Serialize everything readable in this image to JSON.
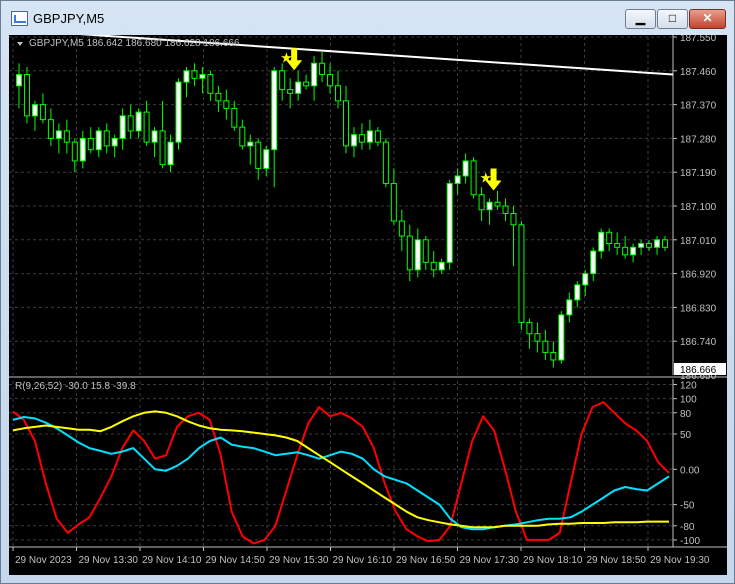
{
  "window": {
    "title": "GBPJPY,M5",
    "minimize_label": "▁",
    "maximize_label": "□",
    "close_label": "✕"
  },
  "main_chart": {
    "header": "GBPJPY,M5  186.642 186.680 186.628 186.666",
    "price_axis": [
      "187.550",
      "187.460",
      "187.370",
      "187.280",
      "187.190",
      "187.100",
      "187.010",
      "186.920",
      "186.830",
      "186.740"
    ],
    "current_price": "186.666",
    "axis_edge_label": "186.650"
  },
  "indicator": {
    "header": "R(9,26,52) -30.0 15.8 -39.8",
    "axis": [
      "120",
      "100",
      "80",
      "50",
      "0.00",
      "-50",
      "-80",
      "-100"
    ]
  },
  "time_axis": [
    "29 Nov 2023",
    "29 Nov 13:30",
    "29 Nov 14:10",
    "29 Nov 14:50",
    "29 Nov 15:30",
    "29 Nov 16:10",
    "29 Nov 16:50",
    "29 Nov 17:30",
    "29 Nov 18:10",
    "29 Nov 18:50",
    "29 Nov 19:30"
  ],
  "colors": {
    "background": "#000000",
    "grid": "#3c3c3c",
    "bull_candle": "#ffffff",
    "bear_candle": "#000000",
    "candle_wick": "#00ff00",
    "trendline": "#ffffff",
    "arrow": "#ffff00",
    "red_line": "#ff0000",
    "cyan_line": "#00e0ff",
    "yellow_line": "#ffff00",
    "current_price_label_bg": "#ffffff"
  },
  "chart_data": {
    "type": "candlestick",
    "symbol": "GBPJPY",
    "timeframe": "M5",
    "ohlc": [
      [
        187.42,
        187.48,
        187.36,
        187.45
      ],
      [
        187.45,
        187.47,
        187.32,
        187.34
      ],
      [
        187.34,
        187.38,
        187.3,
        187.37
      ],
      [
        187.37,
        187.4,
        187.32,
        187.33
      ],
      [
        187.33,
        187.36,
        187.26,
        187.28
      ],
      [
        187.28,
        187.32,
        187.24,
        187.3
      ],
      [
        187.3,
        187.33,
        187.24,
        187.27
      ],
      [
        187.27,
        187.28,
        187.19,
        187.22
      ],
      [
        187.22,
        187.3,
        187.2,
        187.28
      ],
      [
        187.28,
        187.31,
        187.24,
        187.25
      ],
      [
        187.25,
        187.31,
        187.23,
        187.3
      ],
      [
        187.3,
        187.32,
        187.24,
        187.26
      ],
      [
        187.26,
        187.29,
        187.23,
        187.28
      ],
      [
        187.28,
        187.36,
        187.25,
        187.34
      ],
      [
        187.34,
        187.37,
        187.28,
        187.3
      ],
      [
        187.3,
        187.36,
        187.28,
        187.35
      ],
      [
        187.35,
        187.38,
        187.26,
        187.27
      ],
      [
        187.27,
        187.31,
        187.23,
        187.3
      ],
      [
        187.3,
        187.38,
        187.2,
        187.21
      ],
      [
        187.21,
        187.29,
        187.19,
        187.27
      ],
      [
        187.27,
        187.44,
        187.25,
        187.43
      ],
      [
        187.43,
        187.47,
        187.39,
        187.46
      ],
      [
        187.46,
        187.48,
        187.42,
        187.44
      ],
      [
        187.44,
        187.47,
        187.4,
        187.45
      ],
      [
        187.45,
        187.46,
        187.38,
        187.4
      ],
      [
        187.4,
        187.42,
        187.35,
        187.38
      ],
      [
        187.38,
        187.41,
        187.33,
        187.36
      ],
      [
        187.36,
        187.38,
        187.3,
        187.31
      ],
      [
        187.31,
        187.33,
        187.25,
        187.26
      ],
      [
        187.26,
        187.29,
        187.21,
        187.27
      ],
      [
        187.27,
        187.28,
        187.17,
        187.2
      ],
      [
        187.2,
        187.26,
        187.18,
        187.25
      ],
      [
        187.25,
        187.47,
        187.15,
        187.46
      ],
      [
        187.46,
        187.48,
        187.38,
        187.41
      ],
      [
        187.41,
        187.44,
        187.36,
        187.4
      ],
      [
        187.4,
        187.46,
        187.38,
        187.43
      ],
      [
        187.43,
        187.45,
        187.41,
        187.42
      ],
      [
        187.42,
        187.5,
        187.38,
        187.48
      ],
      [
        187.48,
        187.51,
        187.43,
        187.45
      ],
      [
        187.45,
        187.48,
        187.4,
        187.42
      ],
      [
        187.42,
        187.46,
        187.36,
        187.38
      ],
      [
        187.38,
        187.42,
        187.24,
        187.26
      ],
      [
        187.26,
        187.31,
        187.23,
        187.29
      ],
      [
        187.29,
        187.32,
        187.25,
        187.27
      ],
      [
        187.27,
        187.33,
        187.25,
        187.3
      ],
      [
        187.3,
        187.31,
        187.26,
        187.27
      ],
      [
        187.27,
        187.28,
        187.15,
        187.16
      ],
      [
        187.16,
        187.2,
        187.05,
        187.06
      ],
      [
        187.06,
        187.09,
        186.98,
        187.02
      ],
      [
        187.02,
        187.05,
        186.9,
        186.93
      ],
      [
        186.93,
        187.04,
        186.91,
        187.01
      ],
      [
        187.01,
        187.02,
        186.93,
        186.95
      ],
      [
        186.95,
        186.98,
        186.91,
        186.93
      ],
      [
        186.93,
        186.96,
        186.92,
        186.95
      ],
      [
        186.95,
        187.17,
        186.93,
        187.16
      ],
      [
        187.16,
        187.2,
        187.13,
        187.18
      ],
      [
        187.18,
        187.24,
        187.16,
        187.22
      ],
      [
        187.22,
        187.23,
        187.12,
        187.13
      ],
      [
        187.13,
        187.15,
        187.06,
        187.09
      ],
      [
        187.09,
        187.12,
        187.05,
        187.11
      ],
      [
        187.11,
        187.14,
        187.09,
        187.1
      ],
      [
        187.1,
        187.12,
        187.06,
        187.08
      ],
      [
        187.08,
        187.1,
        186.94,
        187.05
      ],
      [
        187.05,
        187.06,
        186.77,
        186.79
      ],
      [
        186.79,
        186.8,
        186.72,
        186.76
      ],
      [
        186.76,
        186.79,
        186.71,
        186.74
      ],
      [
        186.74,
        186.77,
        186.69,
        186.71
      ],
      [
        186.71,
        186.74,
        186.67,
        186.69
      ],
      [
        186.69,
        186.82,
        186.68,
        186.81
      ],
      [
        186.81,
        186.87,
        186.79,
        186.85
      ],
      [
        186.85,
        186.9,
        186.83,
        186.89
      ],
      [
        186.89,
        186.93,
        186.86,
        186.92
      ],
      [
        186.92,
        186.99,
        186.9,
        186.98
      ],
      [
        186.98,
        187.04,
        186.96,
        187.03
      ],
      [
        187.03,
        187.04,
        186.98,
        187.0
      ],
      [
        187.0,
        187.03,
        186.97,
        186.99
      ],
      [
        186.99,
        187.02,
        186.96,
        186.97
      ],
      [
        186.97,
        187.0,
        186.95,
        186.99
      ],
      [
        186.99,
        187.01,
        186.97,
        187.0
      ],
      [
        187.0,
        187.01,
        186.98,
        186.99
      ],
      [
        186.99,
        187.02,
        186.97,
        187.01
      ],
      [
        187.01,
        187.02,
        186.98,
        186.99
      ]
    ],
    "ylim": [
      186.65,
      187.55
    ],
    "trendline": {
      "from": [
        0,
        187.57
      ],
      "to": [
        81,
        187.45
      ]
    },
    "down_arrows_at": [
      34,
      59
    ],
    "indicator": {
      "name": "R(9,26,52)",
      "ylim": [
        -110,
        125
      ],
      "series": [
        {
          "name": "red",
          "color": "#ff0000",
          "values": [
            82,
            70,
            40,
            -20,
            -70,
            -90,
            -78,
            -68,
            -40,
            -10,
            30,
            55,
            40,
            15,
            20,
            60,
            75,
            80,
            70,
            20,
            -60,
            -95,
            -105,
            -100,
            -80,
            -30,
            20,
            65,
            88,
            75,
            80,
            72,
            60,
            30,
            -20,
            -60,
            -85,
            -95,
            -102,
            -100,
            -80,
            -20,
            40,
            75,
            55,
            0,
            -60,
            -100,
            -100,
            -100,
            -90,
            -20,
            50,
            88,
            95,
            80,
            65,
            55,
            40,
            10,
            -5
          ]
        },
        {
          "name": "cyan",
          "color": "#00e0ff",
          "values": [
            70,
            74,
            72,
            66,
            58,
            48,
            38,
            30,
            26,
            22,
            25,
            30,
            15,
            0,
            -2,
            5,
            15,
            30,
            40,
            45,
            35,
            32,
            30,
            25,
            20,
            22,
            24,
            20,
            15,
            20,
            25,
            22,
            15,
            0,
            -10,
            -15,
            -20,
            -30,
            -40,
            -50,
            -70,
            -82,
            -85,
            -85,
            -82,
            -80,
            -78,
            -75,
            -72,
            -70,
            -70,
            -68,
            -60,
            -50,
            -40,
            -30,
            -25,
            -28,
            -30,
            -20,
            -10
          ]
        },
        {
          "name": "yellow",
          "color": "#ffff00",
          "values": [
            55,
            58,
            60,
            62,
            60,
            58,
            56,
            56,
            54,
            60,
            68,
            75,
            80,
            82,
            80,
            75,
            68,
            62,
            58,
            56,
            55,
            54,
            52,
            50,
            48,
            45,
            40,
            30,
            20,
            10,
            0,
            -10,
            -20,
            -30,
            -40,
            -50,
            -60,
            -68,
            -72,
            -75,
            -78,
            -80,
            -82,
            -82,
            -82,
            -80,
            -80,
            -80,
            -80,
            -78,
            -77,
            -77,
            -76,
            -76,
            -76,
            -75,
            -75,
            -75,
            -74,
            -74,
            -74
          ]
        }
      ]
    }
  }
}
